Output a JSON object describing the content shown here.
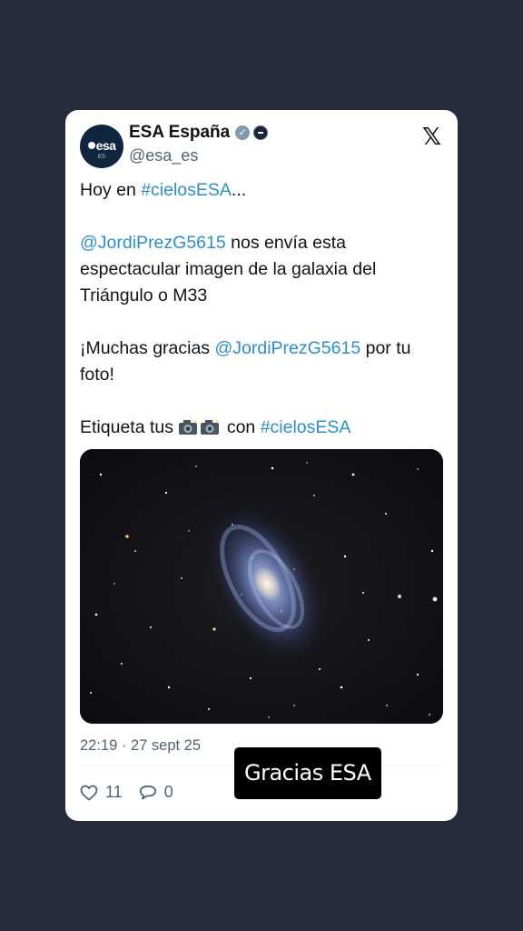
{
  "tweet": {
    "display_name": "ESA España",
    "handle": "@esa_es",
    "avatar": {
      "logo_text": "esa",
      "sub_text": "ES"
    },
    "text": {
      "line1_prefix": "Hoy en ",
      "line1_link": "#cielosESA",
      "line1_suffix": "...",
      "para2_link": "@JordiPrezG5615",
      "para2_text": " nos envía esta espectacular imagen de la galaxia del Triángulo o M33",
      "para3_prefix": "¡Muchas gracias ",
      "para3_link": "@JordiPrezG5615",
      "para3_suffix": " por tu foto!",
      "para4_prefix": "Etiqueta tus ",
      "para4_middle": " con ",
      "para4_link": "#cielosESA"
    },
    "timestamp": "22:19 · 27 sept 25",
    "likes": "11",
    "replies": "0",
    "icons": [
      "verified-badge-icon",
      "esa-affiliate-icon",
      "x-logo-icon",
      "camera-flash-icon",
      "heart-icon",
      "reply-icon"
    ],
    "colors": {
      "link": "#2b8fc9",
      "text": "#0f1419",
      "muted": "#536471",
      "background": "#262c3c"
    }
  },
  "caption": "Gracias ESA"
}
